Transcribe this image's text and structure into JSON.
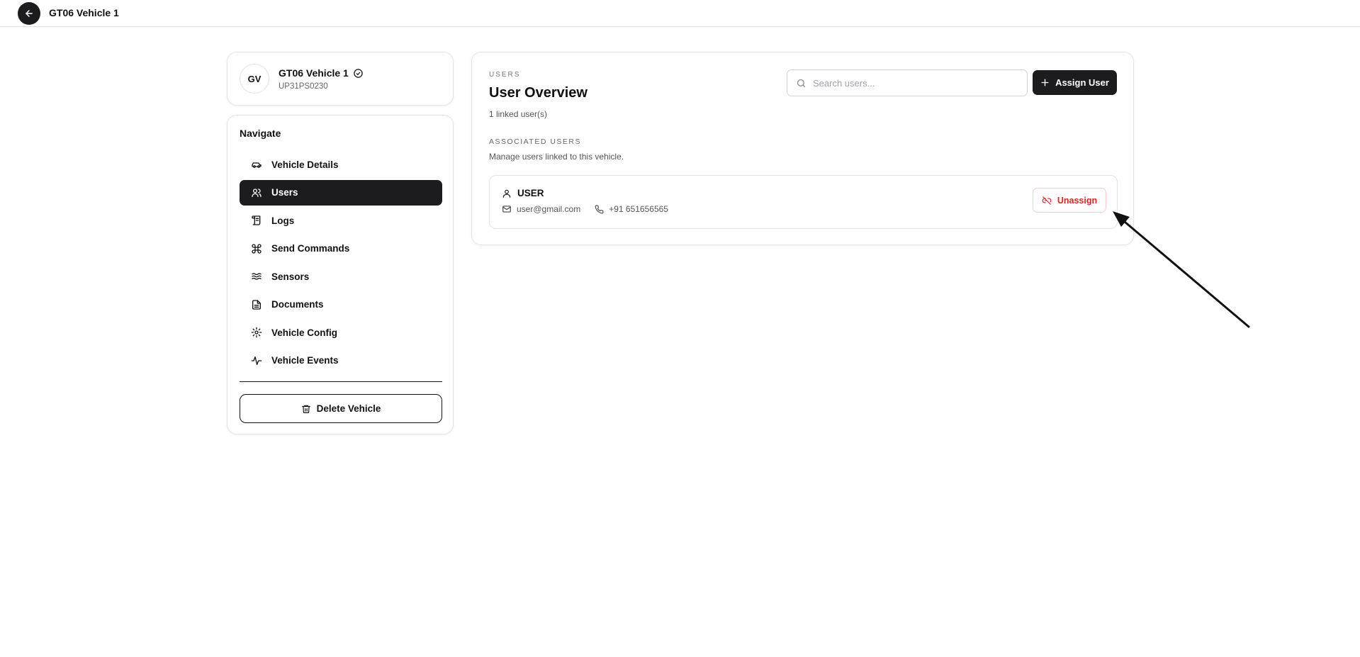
{
  "header": {
    "title": "GT06 Vehicle 1"
  },
  "vehicle": {
    "initials": "GV",
    "name": "GT06 Vehicle 1",
    "plate": "UP31PS0230"
  },
  "navigation": {
    "heading": "Navigate",
    "items": [
      {
        "label": "Vehicle Details",
        "icon": "car-icon",
        "active": false
      },
      {
        "label": "Users",
        "icon": "users-icon",
        "active": true
      },
      {
        "label": "Logs",
        "icon": "scroll-icon",
        "active": false
      },
      {
        "label": "Send Commands",
        "icon": "command-icon",
        "active": false
      },
      {
        "label": "Sensors",
        "icon": "waves-icon",
        "active": false
      },
      {
        "label": "Documents",
        "icon": "document-icon",
        "active": false
      },
      {
        "label": "Vehicle Config",
        "icon": "gear-icon",
        "active": false
      },
      {
        "label": "Vehicle Events",
        "icon": "activity-icon",
        "active": false
      }
    ],
    "delete_label": "Delete Vehicle"
  },
  "main": {
    "eyebrow": "USERS",
    "title": "User Overview",
    "linked_count": "1 linked user(s)",
    "search_placeholder": "Search users...",
    "assign_label": "Assign User",
    "section_label": "ASSOCIATED USERS",
    "section_description": "Manage users linked to this vehicle.",
    "users": [
      {
        "name": "USER",
        "email": "user@gmail.com",
        "phone": "+91 651656565",
        "action_label": "Unassign"
      }
    ]
  },
  "colors": {
    "primary_dark": "#1c1c1e",
    "danger": "#dc2626",
    "border": "#e4e4e7"
  }
}
